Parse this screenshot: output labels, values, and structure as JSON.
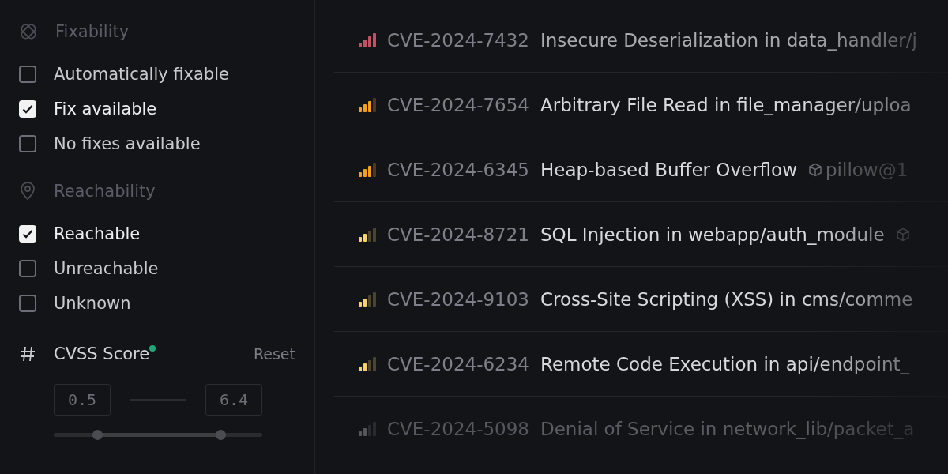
{
  "filters": [
    {
      "kind": "fixability",
      "title": "Fixability",
      "options": [
        {
          "label": "Automatically fixable",
          "checked": false
        },
        {
          "label": "Fix available",
          "checked": true
        },
        {
          "label": "No fixes available",
          "checked": false
        }
      ]
    },
    {
      "kind": "reachability",
      "title": "Reachability",
      "options": [
        {
          "label": "Reachable",
          "checked": true
        },
        {
          "label": "Unreachable",
          "checked": false
        },
        {
          "label": "Unknown",
          "checked": false
        }
      ]
    }
  ],
  "cvss": {
    "title": "CVSS Score",
    "modified": true,
    "reset": "Reset",
    "min": "0.5",
    "max": "6.4",
    "thumbs": [
      {
        "level": 0.21
      },
      {
        "level": 0.8
      }
    ]
  },
  "vulnerabilities": [
    {
      "kind": "critical",
      "color": "#c05263",
      "id": "CVE-2024-7432",
      "title": "Insecure Deserialization in data_handler/j",
      "package_icon": false
    },
    {
      "kind": "high",
      "color": "#f4a01c",
      "id": "CVE-2024-7654",
      "title": "Arbitrary File Read in file_manager/uploa",
      "package_icon": false
    },
    {
      "kind": "high",
      "color": "#f4a01c",
      "id": "CVE-2024-6345",
      "title": "Heap-based Buffer Overflow",
      "package_icon": true,
      "package": "pillow@1"
    },
    {
      "kind": "medium",
      "color": "#f5d46a",
      "id": "CVE-2024-8721",
      "title": "SQL Injection in webapp/auth_module",
      "package_icon": true
    },
    {
      "kind": "medium",
      "color": "#f5d46a",
      "id": "CVE-2024-9103",
      "title": "Cross-Site Scripting (XSS) in cms/comme",
      "package_icon": false
    },
    {
      "kind": "medium",
      "color": "#f5d46a",
      "id": "CVE-2024-6234",
      "title": "Remote Code Execution in api/endpoint_",
      "package_icon": false
    },
    {
      "kind": "low",
      "color": "#55575d",
      "id": "CVE-2024-5098",
      "title": "Denial of Service in network_lib/packet_a",
      "package_icon": false
    }
  ]
}
